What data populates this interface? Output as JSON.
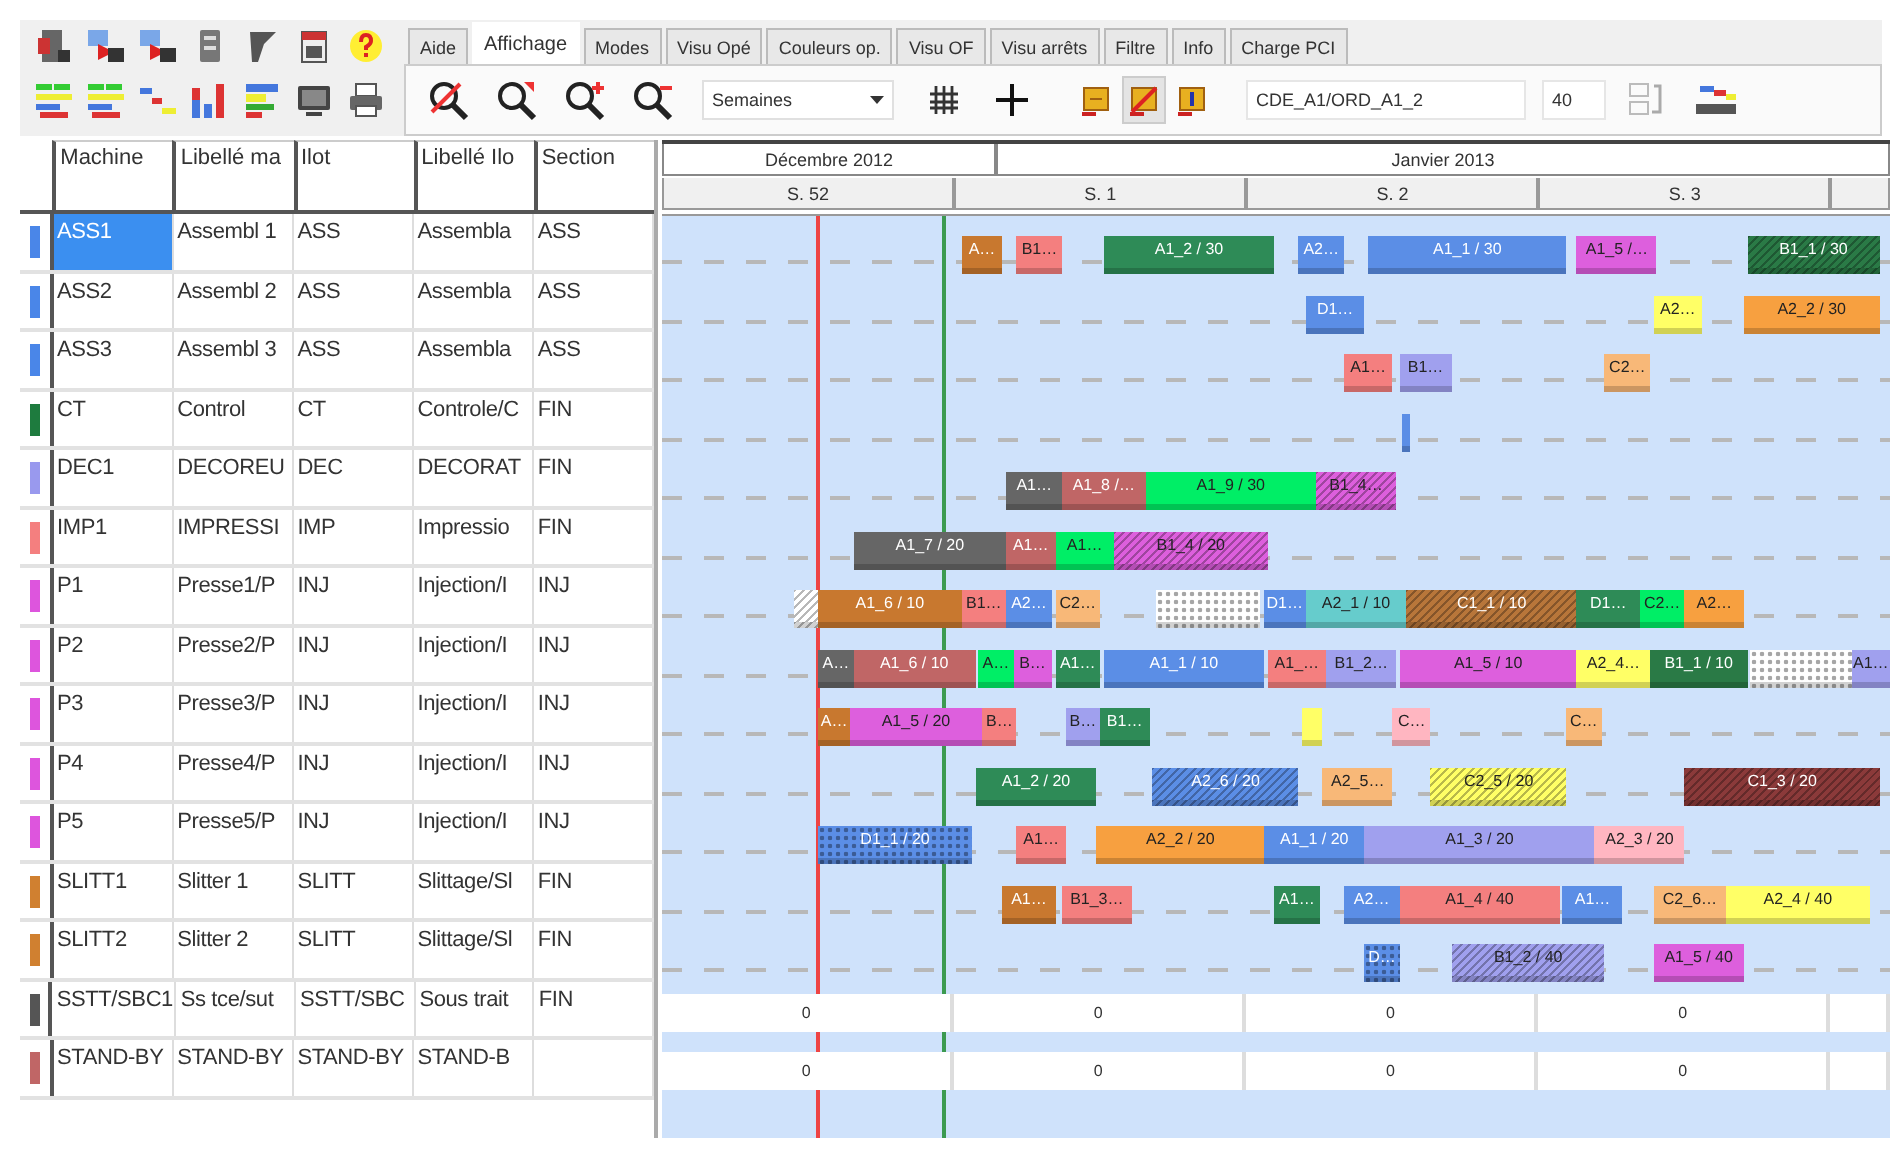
{
  "tabs": [
    {
      "label": "Aide",
      "selected": false
    },
    {
      "label": "Affichage",
      "selected": true
    },
    {
      "label": "Modes",
      "selected": false
    },
    {
      "label": "Visu Opé",
      "selected": false
    },
    {
      "label": "Couleurs op.",
      "selected": false
    },
    {
      "label": "Visu OF",
      "selected": false
    },
    {
      "label": "Visu arrêts",
      "selected": false
    },
    {
      "label": "Filtre",
      "selected": false
    },
    {
      "label": "Info",
      "selected": false
    },
    {
      "label": "Charge PCI",
      "selected": false
    }
  ],
  "scale_select": {
    "value": "Semaines"
  },
  "note_buttons": [
    {
      "selected": false
    },
    {
      "selected": true
    },
    {
      "selected": false
    }
  ],
  "order_field": {
    "value": "CDE_A1/ORD_A1_2"
  },
  "quantity_field": {
    "value": "40"
  },
  "table": {
    "columns": [
      "Machine",
      "Libellé ma",
      "Ilot",
      "Libellé Ilo",
      "Section"
    ],
    "rows": [
      {
        "color": "#4a86e8",
        "selected": true,
        "cells": [
          "ASS1",
          "Assembl 1",
          "ASS",
          "Assembla",
          "ASS"
        ],
        "bars": [
          {
            "kind": "solid",
            "label": "A…",
            "color": "#c8782f"
          },
          {
            "kind": "solid",
            "label": "B1…",
            "color": "#f47f7f"
          },
          {
            "kind": "solid",
            "label": "A1_2 / 30",
            "color": "#2e8b57"
          },
          {
            "kind": "solid",
            "label": "A2…",
            "color": "#5b8ee6"
          },
          {
            "kind": "solid",
            "label": "A1_1 / 30",
            "color": "#5b8ee6"
          },
          {
            "kind": "solid",
            "label": "A1_5 /…",
            "color": "#dd5fdd"
          },
          {
            "kind": "hatched",
            "label": "B1_1 / 30",
            "color": "#2a7a46"
          }
        ]
      },
      {
        "color": "#4a86e8",
        "selected": false,
        "cells": [
          "ASS2",
          "Assembl 2",
          "ASS",
          "Assembla",
          "ASS"
        ],
        "bars": [
          {
            "kind": "solid",
            "label": "D1…",
            "color": "#5b8ee6"
          },
          {
            "kind": "solid",
            "label": "A2…",
            "color": "#ffff66"
          },
          {
            "kind": "solid",
            "label": "A2_2 / 30",
            "color": "#f7a040"
          }
        ]
      },
      {
        "color": "#4a86e8",
        "selected": false,
        "cells": [
          "ASS3",
          "Assembl 3",
          "ASS",
          "Assembla",
          "ASS"
        ],
        "bars": [
          {
            "kind": "solid",
            "label": "A1…",
            "color": "#f47f7f"
          },
          {
            "kind": "solid",
            "label": "B1…",
            "color": "#a0a0ee"
          },
          {
            "kind": "solid",
            "label": "C2…",
            "color": "#f8b878"
          }
        ]
      },
      {
        "color": "#1e7b3e",
        "selected": false,
        "cells": [
          "CT",
          "Control",
          "CT",
          "Controle/C",
          "FIN"
        ],
        "bars": [
          {
            "kind": "solid",
            "color": "#5b8ee6"
          }
        ]
      },
      {
        "color": "#9999ee",
        "selected": false,
        "cells": [
          "DEC1",
          "DECOREU",
          "DEC",
          "DECORAT",
          "FIN"
        ],
        "bars": [
          {
            "kind": "solid",
            "label": "A1…",
            "color": "#666666"
          },
          {
            "kind": "solid",
            "label": "A1_8 /…",
            "color": "#c06666"
          },
          {
            "kind": "solid",
            "label": "A1_9 / 30",
            "color": "#00ee66"
          },
          {
            "kind": "hatched",
            "label": "B1_4…",
            "color": "#dd5fdd"
          }
        ]
      },
      {
        "color": "#f47f7f",
        "selected": false,
        "cells": [
          "IMP1",
          "IMPRESSI",
          "IMP",
          "Impressio",
          "FIN"
        ],
        "bars": [
          {
            "kind": "solid",
            "label": "A1_7 / 20",
            "color": "#666666"
          },
          {
            "kind": "solid",
            "label": "A1…",
            "color": "#c06666"
          },
          {
            "kind": "solid",
            "label": "A1…",
            "color": "#00ee66"
          },
          {
            "kind": "hatched",
            "label": "B1_4 / 20",
            "color": "#dd5fdd"
          }
        ]
      },
      {
        "color": "#dd55dd",
        "selected": false,
        "cells": [
          "P1",
          "Presse1/P",
          "INJ",
          "Injection/I",
          "INJ"
        ],
        "bars": [
          {
            "kind": "hatched",
            "color": "#ffffff"
          },
          {
            "kind": "solid",
            "label": "A1_6 / 10",
            "color": "#c8782f"
          },
          {
            "kind": "solid",
            "label": "B1…",
            "color": "#f47f7f"
          },
          {
            "kind": "solid",
            "label": "A2…",
            "color": "#5b8ee6"
          },
          {
            "kind": "solid",
            "label": "C2…",
            "color": "#f8b878"
          },
          {
            "kind": "dotted",
            "color": "#ffffff"
          },
          {
            "kind": "solid",
            "label": "D1…",
            "color": "#5b8ee6"
          },
          {
            "kind": "solid",
            "label": "A2_1 / 10",
            "color": "#66cccc"
          },
          {
            "kind": "hatched",
            "label": "C1_1 / 10",
            "color": "#b8763a"
          },
          {
            "kind": "solid",
            "label": "D1…",
            "color": "#2e8b57"
          },
          {
            "kind": "solid",
            "label": "C2…",
            "color": "#00ee66"
          },
          {
            "kind": "solid",
            "label": "A2…",
            "color": "#f7a040"
          }
        ]
      },
      {
        "color": "#dd55dd",
        "selected": false,
        "cells": [
          "P2",
          "Presse2/P",
          "INJ",
          "Injection/I",
          "INJ"
        ],
        "bars": [
          {
            "kind": "solid",
            "label": "A…",
            "color": "#666666"
          },
          {
            "kind": "solid",
            "label": "A1_6 / 10",
            "color": "#c06666"
          },
          {
            "kind": "solid",
            "label": "A…",
            "color": "#00ee66"
          },
          {
            "kind": "solid",
            "label": "B…",
            "color": "#dd5fdd"
          },
          {
            "kind": "solid",
            "label": "A1…",
            "color": "#2e8b57"
          },
          {
            "kind": "solid",
            "label": "A1_1 / 10",
            "color": "#5b8ee6"
          },
          {
            "kind": "solid",
            "label": "A1_…",
            "color": "#f47f7f"
          },
          {
            "kind": "solid",
            "label": "B1_2…",
            "color": "#a0a0ee"
          },
          {
            "kind": "solid",
            "label": "A1_5 / 10",
            "color": "#dd5fdd"
          },
          {
            "kind": "solid",
            "label": "A2_4…",
            "color": "#ffff66"
          },
          {
            "kind": "solid",
            "label": "B1_1 / 10",
            "color": "#2a7a46"
          },
          {
            "kind": "dotted",
            "color": "#ffffff"
          },
          {
            "kind": "solid",
            "label": "A1…",
            "color": "#a0a0ee"
          }
        ]
      },
      {
        "color": "#dd55dd",
        "selected": false,
        "cells": [
          "P3",
          "Presse3/P",
          "INJ",
          "Injection/I",
          "INJ"
        ],
        "bars": [
          {
            "kind": "solid",
            "label": "A…",
            "color": "#c8782f"
          },
          {
            "kind": "solid",
            "label": "A1_5 / 20",
            "color": "#dd5fdd"
          },
          {
            "kind": "solid",
            "label": "B…",
            "color": "#f47f7f"
          },
          {
            "kind": "solid",
            "label": "B…",
            "color": "#a0a0ee"
          },
          {
            "kind": "solid",
            "label": "B1…",
            "color": "#2e8b57"
          },
          {
            "kind": "solid",
            "color": "#ffff66"
          },
          {
            "kind": "solid",
            "label": "C…",
            "color": "#ffb6c1"
          },
          {
            "kind": "solid",
            "label": "C…",
            "color": "#f8b878"
          }
        ]
      },
      {
        "color": "#dd55dd",
        "selected": false,
        "cells": [
          "P4",
          "Presse4/P",
          "INJ",
          "Injection/I",
          "INJ"
        ],
        "bars": [
          {
            "kind": "solid",
            "label": "A1_2 / 20",
            "color": "#2e8b57"
          },
          {
            "kind": "hatched",
            "label": "A2_6 / 20",
            "color": "#5b8ee6"
          },
          {
            "kind": "solid",
            "label": "A2_5…",
            "color": "#f8b878"
          },
          {
            "kind": "hatched",
            "label": "C2_5 / 20",
            "color": "#ffff66"
          },
          {
            "kind": "hatched",
            "label": "C1_3 / 20",
            "color": "#8b3a3a"
          }
        ]
      },
      {
        "color": "#dd55dd",
        "selected": false,
        "cells": [
          "P5",
          "Presse5/P",
          "INJ",
          "Injection/I",
          "INJ"
        ],
        "bars": [
          {
            "kind": "dotted",
            "label": "D1_1 / 20",
            "color": "#5b8ee6"
          },
          {
            "kind": "solid",
            "label": "A1…",
            "color": "#f47f7f"
          },
          {
            "kind": "solid",
            "label": "A2_2 / 20",
            "color": "#f7a040"
          },
          {
            "kind": "solid",
            "label": "A1_1 / 20",
            "color": "#5b8ee6"
          },
          {
            "kind": "solid",
            "label": "A1_3 / 20",
            "color": "#a0a0ee"
          },
          {
            "kind": "solid",
            "label": "A2_3 / 20",
            "color": "#ffb6c1"
          }
        ]
      },
      {
        "color": "#d08030",
        "selected": false,
        "cells": [
          "SLITT1",
          "Slitter 1",
          "SLITT",
          "Slittage/Sl",
          "FIN"
        ],
        "bars": [
          {
            "kind": "solid",
            "label": "A1…",
            "color": "#c8782f"
          },
          {
            "kind": "solid",
            "label": "B1_3…",
            "color": "#f47f7f"
          },
          {
            "kind": "solid",
            "label": "A1…",
            "color": "#2e8b57"
          },
          {
            "kind": "solid",
            "label": "A2…",
            "color": "#5b8ee6"
          },
          {
            "kind": "solid",
            "label": "A1_4 / 40",
            "color": "#f47f7f"
          },
          {
            "kind": "solid",
            "label": "A1…",
            "color": "#5b8ee6"
          },
          {
            "kind": "solid",
            "label": "C2_6…",
            "color": "#f8b878"
          },
          {
            "kind": "solid",
            "label": "A2_4 / 40",
            "color": "#ffff66"
          }
        ]
      },
      {
        "color": "#d08030",
        "selected": false,
        "cells": [
          "SLITT2",
          "Slitter 2",
          "SLITT",
          "Slittage/Sl",
          "FIN"
        ],
        "bars": [
          {
            "kind": "dotted",
            "label": "D…",
            "color": "#5b8ee6"
          },
          {
            "kind": "hatched",
            "label": "B1_2 / 40",
            "color": "#a0a0ee"
          },
          {
            "kind": "solid",
            "label": "A1_5 / 40",
            "color": "#dd5fdd"
          }
        ]
      },
      {
        "color": "#555555",
        "selected": false,
        "cells": [
          "SSTT/SBC1",
          "Ss tce/sut",
          "SSTT/SBC",
          "Sous trait",
          "FIN"
        ],
        "capacity": [
          "0",
          "0",
          "0",
          "0"
        ]
      },
      {
        "color": "#c06666",
        "selected": false,
        "cells": [
          "STAND-BY",
          "STAND-BY",
          "STAND-BY",
          "STAND-B"
        ],
        "capacity": [
          "0",
          "0",
          "0",
          "0"
        ]
      }
    ]
  },
  "gantt": {
    "months": [
      "Décembre 2012",
      "Janvier 2013"
    ],
    "weeks": [
      "S. 52",
      "S. 1",
      "S. 2",
      "S. 3"
    ],
    "markers": [
      {
        "color": "#ee4444"
      },
      {
        "color": "#3c9a50"
      }
    ]
  }
}
